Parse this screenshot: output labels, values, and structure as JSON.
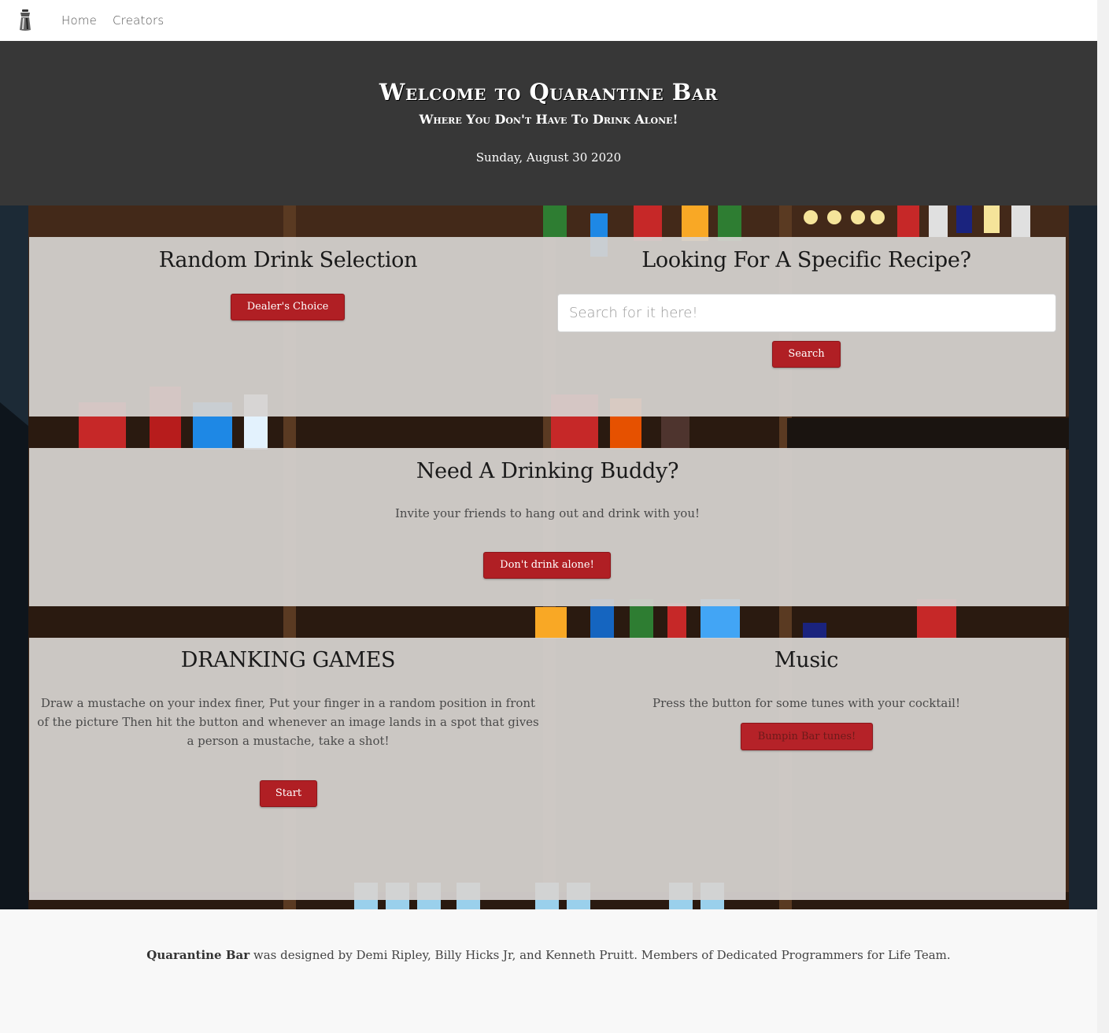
{
  "nav": {
    "logo_icon": "cocktail-shaker-icon",
    "links": [
      {
        "label": "Home"
      },
      {
        "label": "Creators"
      }
    ]
  },
  "hero": {
    "title": "Welcome to Quarantine Bar",
    "subtitle": "Where You Don't Have To Drink Alone!",
    "date": "Sunday, August 30 2020"
  },
  "random": {
    "heading": "Random Drink Selection",
    "button": "Dealer's Choice"
  },
  "recipe": {
    "heading": "Looking For A Specific Recipe?",
    "placeholder": "Search for it here!",
    "button": "Search"
  },
  "buddy": {
    "heading": "Need A Drinking Buddy?",
    "text": "Invite your friends to hang out and drink with you!",
    "button": "Don't drink alone!"
  },
  "games": {
    "heading": "DRANKING GAMES",
    "text_line1": "Draw a mustache on your index finer, Put your finger in a random position in front",
    "text_line2": "of the picture Then hit the button and whenever an image lands in a spot that gives",
    "text_line3": "a person a mustache, take a shot!",
    "button": "Start"
  },
  "music": {
    "heading": "Music",
    "text": "Press the button for some tunes with your cocktail!",
    "button": "Bumpin Bar tunes!"
  },
  "footer": {
    "brand": "Quarantine Bar",
    "text": " was designed by Demi Ripley, Billy Hicks Jr, and Kenneth Pruitt. Members of Dedicated Programmers for Life Team."
  },
  "colors": {
    "hero_bg": "#373737",
    "button_red": "#b01f24",
    "card_bg": "#d6d3d1",
    "footer_bg": "#f8f8f8"
  }
}
